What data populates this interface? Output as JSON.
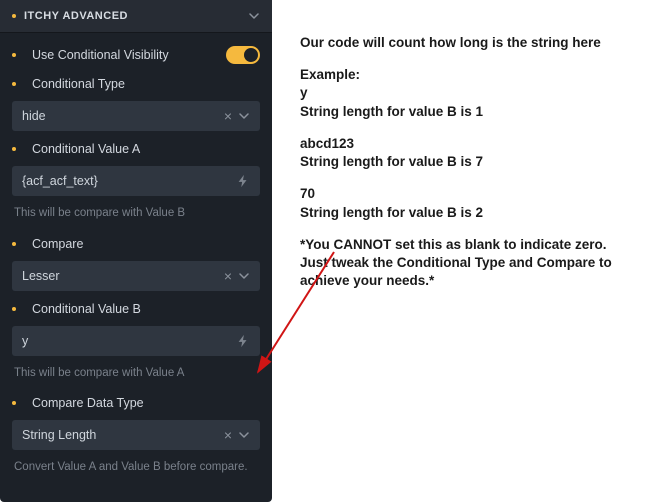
{
  "panel": {
    "title": "ITCHY ADVANCED",
    "fields": {
      "useConditional": {
        "label": "Use Conditional Visibility",
        "on": true
      },
      "conditionalType": {
        "label": "Conditional Type",
        "value": "hide"
      },
      "condValueA": {
        "label": "Conditional Value A",
        "value": "{acf_acf_text}",
        "hint": "This will be compare with Value B"
      },
      "compare": {
        "label": "Compare",
        "value": "Lesser"
      },
      "condValueB": {
        "label": "Conditional Value B",
        "value": "y",
        "hint": "This will be compare with Value A"
      },
      "compareDataType": {
        "label": "Compare Data Type",
        "value": "String Length",
        "hint": "Convert Value A and Value B before compare."
      }
    }
  },
  "doc": {
    "intro": "Our code will count how long is the string here",
    "exampleHeading": "Example:",
    "ex1_in": "y",
    "ex1_out": "String length for value B is 1",
    "ex2_in": "abcd123",
    "ex2_out": "String length for value B is 7",
    "ex3_in": "70",
    "ex3_out": "String length for value B is 2",
    "note": "*You CANNOT set this as blank to indicate zero. Just tweak the Conditional Type and Compare to achieve your needs.*"
  }
}
